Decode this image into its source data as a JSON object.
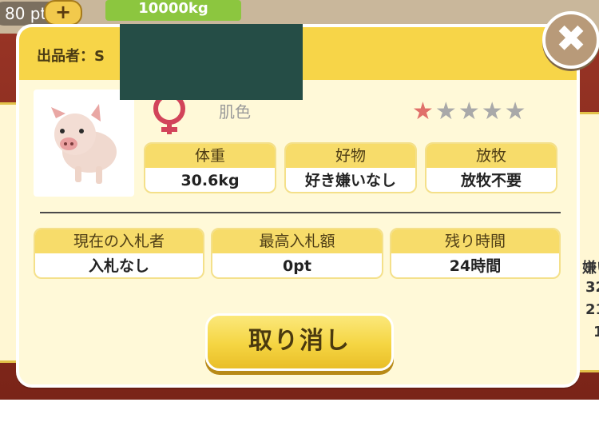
{
  "background": {
    "points_text": "80 pt",
    "banner_text": "10000kg"
  },
  "modal": {
    "seller_label": "出品者：S",
    "close_glyph": "✖",
    "pig": {
      "skin_label": "肌色",
      "rating": 1,
      "rating_max": 5,
      "stars": [
        "★",
        "★",
        "★",
        "★",
        "★"
      ]
    },
    "info": [
      {
        "label": "体重",
        "value": "30.6kg"
      },
      {
        "label": "好物",
        "value": "好き嫌いなし"
      },
      {
        "label": "放牧",
        "value": "放牧不要"
      }
    ],
    "bid": [
      {
        "label": "現在の入札者",
        "value": "入札なし"
      },
      {
        "label": "最高入札額",
        "value": "0pt"
      },
      {
        "label": "残り時間",
        "value": "24時間"
      }
    ],
    "cancel_label": "取り消し"
  },
  "side_right": [
    "嫌い",
    "32",
    "21",
    "1"
  ],
  "colors": {
    "header": "#f7d548",
    "accent_star": "#e0706a",
    "gender": "#d2445a"
  }
}
